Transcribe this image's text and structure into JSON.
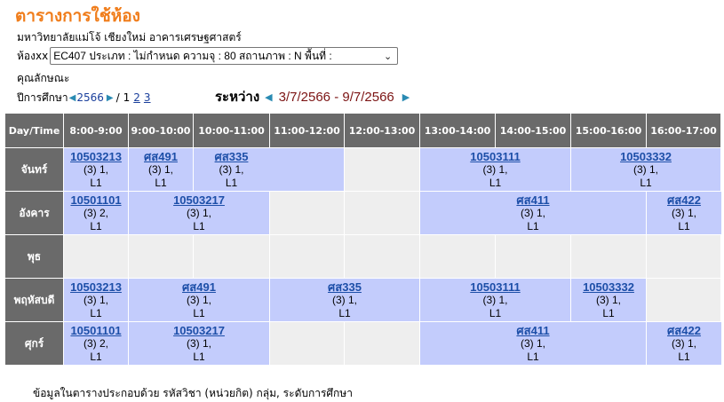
{
  "header": {
    "title": "ตารางการใช้ห้อง",
    "university": "มหาวิทยาลัยแม่โจ้ เชียงใหม่ อาคารเศรษฐศาสตร์",
    "room_label": "ห้องxx",
    "room_select_value": "EC407 ประเภท : ไม่กำหนด ความจุ : 80 สถานภาพ : N พื้นที่ :",
    "feature_label": "คุณลักษณะ",
    "year_label": "ปีการศึกษา",
    "year": "2566",
    "page_sep": "/",
    "pages": [
      "1",
      "2",
      "3"
    ],
    "between_label": "ระหว่าง",
    "date_range": "3/7/2566 - 9/7/2566"
  },
  "grid": {
    "corner": "Day/Time",
    "times": [
      "8:00-9:00",
      "9:00-10:00",
      "10:00-11:00",
      "11:00-12:00",
      "12:00-13:00",
      "13:00-14:00",
      "14:00-15:00",
      "15:00-16:00",
      "16:00-17:00"
    ],
    "days": [
      {
        "name": "จันทร์",
        "cells": [
          {
            "code": "10503213",
            "info": "(3) 1,",
            "level": "L1"
          },
          {
            "code": "ศส491",
            "info": "(3) 1,",
            "level": "L1"
          },
          {
            "code": "ศส335",
            "info": "(3) 1,",
            "level": "L1"
          },
          {
            "code": "10503111",
            "info": "(3) 1,",
            "level": "L1"
          },
          {
            "code": "10503332",
            "info": "(3) 1,",
            "level": "L1"
          }
        ]
      },
      {
        "name": "อังคาร",
        "cells": [
          {
            "code": "10501101",
            "info": "(3) 2,",
            "level": "L1"
          },
          {
            "code": "10503217",
            "info": "(3) 1,",
            "level": "L1"
          },
          {
            "code": "ศส411",
            "info": "(3) 1,",
            "level": "L1"
          },
          {
            "code": "ศส422",
            "info": "(3) 1,",
            "level": "L1"
          }
        ]
      },
      {
        "name": "พุธ",
        "cells": []
      },
      {
        "name": "พฤหัสบดี",
        "cells": [
          {
            "code": "10503213",
            "info": "(3) 1,",
            "level": "L1"
          },
          {
            "code": "ศส491",
            "info": "(3) 1,",
            "level": "L1"
          },
          {
            "code": "ศส335",
            "info": "(3) 1,",
            "level": "L1"
          },
          {
            "code": "10503111",
            "info": "(3) 1,",
            "level": "L1"
          },
          {
            "code": "10503332",
            "info": "(3) 1,",
            "level": "L1"
          }
        ]
      },
      {
        "name": "ศุกร์",
        "cells": [
          {
            "code": "10501101",
            "info": "(3) 2,",
            "level": "L1"
          },
          {
            "code": "10503217",
            "info": "(3) 1,",
            "level": "L1"
          },
          {
            "code": "ศส411",
            "info": "(3) 1,",
            "level": "L1"
          },
          {
            "code": "ศส422",
            "info": "(3) 1,",
            "level": "L1"
          }
        ]
      }
    ]
  },
  "footer": {
    "note": "ข้อมูลในตารางประกอบด้วย รหัสวิชา (หน่วยกิต) กลุ่ม, ระดับการศึกษา"
  }
}
